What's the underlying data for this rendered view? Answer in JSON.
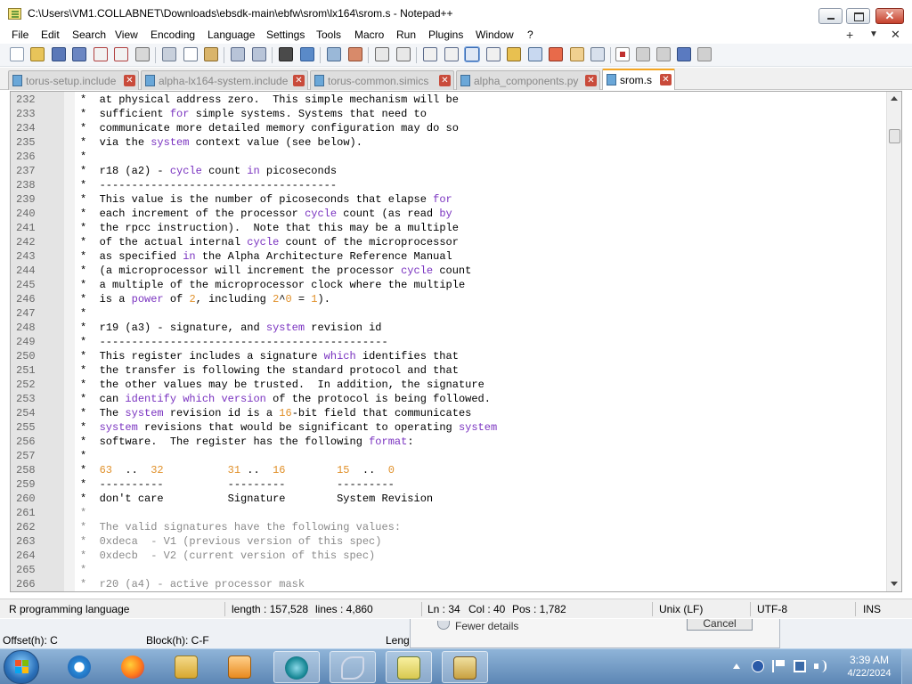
{
  "window": {
    "title": "C:\\Users\\VM1.COLLABNET\\Downloads\\ebsdk-main\\ebfw\\srom\\lx164\\srom.s - Notepad++",
    "close_glyph": "✕"
  },
  "menu": {
    "items": [
      "File",
      "Edit",
      "Search",
      "View",
      "Encoding",
      "Language",
      "Settings",
      "Tools",
      "Macro",
      "Run",
      "Plugins",
      "Window",
      "?"
    ],
    "add_glyph": "+",
    "dropdown_glyph": "▼",
    "close_glyph": "✕"
  },
  "toolbar": {
    "icons": [
      "new-file-icon",
      "open-file-icon",
      "save-icon",
      "save-all-icon",
      "close-icon",
      "close-all-icon",
      "print-icon",
      "cut-icon",
      "copy-icon",
      "paste-icon",
      "undo-icon",
      "redo-icon",
      "find-icon",
      "replace-icon",
      "zoom-in-icon",
      "zoom-out-icon",
      "sync-vertical-icon",
      "sync-horizontal-icon",
      "word-wrap-icon",
      "show-all-chars-icon",
      "indent-guide-icon",
      "user-language-icon",
      "document-map-icon",
      "function-list-icon",
      "folder-workspace-icon",
      "monitoring-icon",
      "record-macro-icon",
      "stop-macro-icon",
      "play-macro-icon",
      "run-macro-multiple-icon",
      "save-macro-icon"
    ]
  },
  "tabs": [
    {
      "label": "torus-setup.include",
      "active": false,
      "close_glyph": "✕"
    },
    {
      "label": "alpha-lx164-system.include",
      "active": false,
      "close_glyph": "✕"
    },
    {
      "label": "torus-common.simics",
      "active": false,
      "close_glyph": "✕"
    },
    {
      "label": "alpha_components.py",
      "active": false,
      "close_glyph": "✕"
    },
    {
      "label": "srom.s",
      "active": true,
      "close_glyph": "✕"
    }
  ],
  "editor": {
    "lines": [
      {
        "n": "232",
        "text": "*  at physical address zero.  This simple mechanism will be"
      },
      {
        "n": "233",
        "text": "*  sufficient for simple systems. Systems that need to"
      },
      {
        "n": "234",
        "text": "*  communicate more detailed memory configuration may do so"
      },
      {
        "n": "235",
        "text": "*  via the system context value (see below)."
      },
      {
        "n": "236",
        "text": "*"
      },
      {
        "n": "237",
        "text": "*  r18 (a2) - cycle count in picoseconds"
      },
      {
        "n": "238",
        "text": "*  -------------------------------------"
      },
      {
        "n": "239",
        "text": "*  This value is the number of picoseconds that elapse for"
      },
      {
        "n": "240",
        "text": "*  each increment of the processor cycle count (as read by"
      },
      {
        "n": "241",
        "text": "*  the rpcc instruction).  Note that this may be a multiple"
      },
      {
        "n": "242",
        "text": "*  of the actual internal cycle count of the microprocessor"
      },
      {
        "n": "243",
        "text": "*  as specified in the Alpha Architecture Reference Manual"
      },
      {
        "n": "244",
        "text": "*  (a microprocessor will increment the processor cycle count"
      },
      {
        "n": "245",
        "text": "*  a multiple of the microprocessor clock where the multiple"
      },
      {
        "n": "246",
        "text": "*  is a power of 2, including 2^0 = 1)."
      },
      {
        "n": "247",
        "text": "*"
      },
      {
        "n": "248",
        "text": "*  r19 (a3) - signature, and system revision id"
      },
      {
        "n": "249",
        "text": "*  ---------------------------------------------"
      },
      {
        "n": "250",
        "text": "*  This register includes a signature which identifies that"
      },
      {
        "n": "251",
        "text": "*  the transfer is following the standard protocol and that"
      },
      {
        "n": "252",
        "text": "*  the other values may be trusted.  In addition, the signature"
      },
      {
        "n": "253",
        "text": "*  can identify which version of the protocol is being followed."
      },
      {
        "n": "254",
        "text": "*  The system revision id is a 16-bit field that communicates"
      },
      {
        "n": "255",
        "text": "*  system revisions that would be significant to operating system"
      },
      {
        "n": "256",
        "text": "*  software.  The register has the following format:"
      },
      {
        "n": "257",
        "text": "*"
      },
      {
        "n": "258",
        "text": "*  63  ..  32          31 ..  16        15  ..  0"
      },
      {
        "n": "259",
        "text": "*  ----------          ---------        ---------"
      },
      {
        "n": "260",
        "text": "*  don't care          Signature        System Revision"
      },
      {
        "n": "261",
        "text": "*"
      },
      {
        "n": "262",
        "text": "*  The valid signatures have the following values:"
      },
      {
        "n": "263",
        "text": "*  0xdeca  - V1 (previous version of this spec)"
      },
      {
        "n": "264",
        "text": "*  0xdecb  - V2 (current version of this spec)"
      },
      {
        "n": "265",
        "text": "*"
      },
      {
        "n": "266",
        "text": "*  r20 (a4) - active processor mask"
      }
    ],
    "keywords": [
      "for",
      "system",
      "cycle",
      "in",
      "by",
      "power",
      "which",
      "identify",
      "version",
      "format"
    ],
    "colors": {
      "keyword": "#7a33c0",
      "number": "#e0902a",
      "comment_faint": "#8a8a8a",
      "gutter": "#e4e4e4"
    }
  },
  "statusbar": {
    "language": "R programming language",
    "length": "length : 157,528",
    "lines": "lines : 4,860",
    "ln": "Ln : 34",
    "col": "Col : 40",
    "pos": "Pos : 1,782",
    "eol": "Unix (LF)",
    "encoding": "UTF-8",
    "mode": "INS"
  },
  "background_window": {
    "fewer_details": "Fewer details",
    "cancel": "Cancel",
    "offset": "Offset(h): C",
    "block": "Block(h): C-F",
    "length": "Leng"
  },
  "taskbar": {
    "apps": [
      "internet-explorer-icon",
      "firefox-icon",
      "file-explorer-icon",
      "media-player-icon",
      "simics-icon",
      "app-script-icon",
      "notepad-plus-plus-icon",
      "hxd-icon"
    ],
    "clock_time": "3:39 AM",
    "clock_date": "4/22/2024"
  }
}
